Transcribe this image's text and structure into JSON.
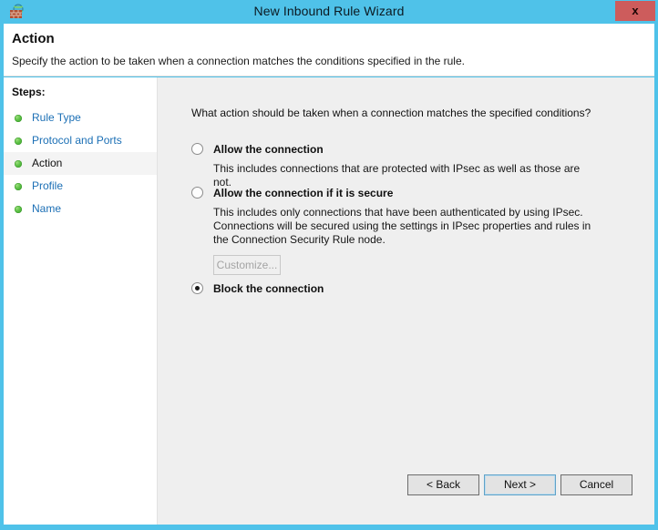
{
  "window": {
    "title": "New Inbound Rule Wizard",
    "icon": "firewall-icon",
    "close_label": "x",
    "titlebar_color": "#4fc2e9",
    "close_color": "#cd5c5c"
  },
  "header": {
    "title": "Action",
    "subtitle": "Specify the action to be taken when a connection matches the conditions specified in the rule."
  },
  "sidebar": {
    "label": "Steps:",
    "items": [
      {
        "label": "Rule Type",
        "current": false
      },
      {
        "label": "Protocol and Ports",
        "current": false
      },
      {
        "label": "Action",
        "current": true
      },
      {
        "label": "Profile",
        "current": false
      },
      {
        "label": "Name",
        "current": false
      }
    ]
  },
  "main": {
    "question": "What action should be taken when a connection matches the specified conditions?",
    "options": [
      {
        "label": "Allow the connection",
        "description": "This includes connections that are protected with IPsec as well as those are not.",
        "selected": false
      },
      {
        "label": "Allow the connection if it is secure",
        "description": "This includes only connections that have been authenticated by using IPsec.  Connections will be secured using the settings in IPsec properties and rules in the Connection Security Rule node.",
        "selected": false,
        "customize_label": "Customize...",
        "customize_enabled": false
      },
      {
        "label": "Block the connection",
        "description": "",
        "selected": true
      }
    ]
  },
  "footer": {
    "back_label": "< Back",
    "next_label": "Next >",
    "cancel_label": "Cancel"
  }
}
